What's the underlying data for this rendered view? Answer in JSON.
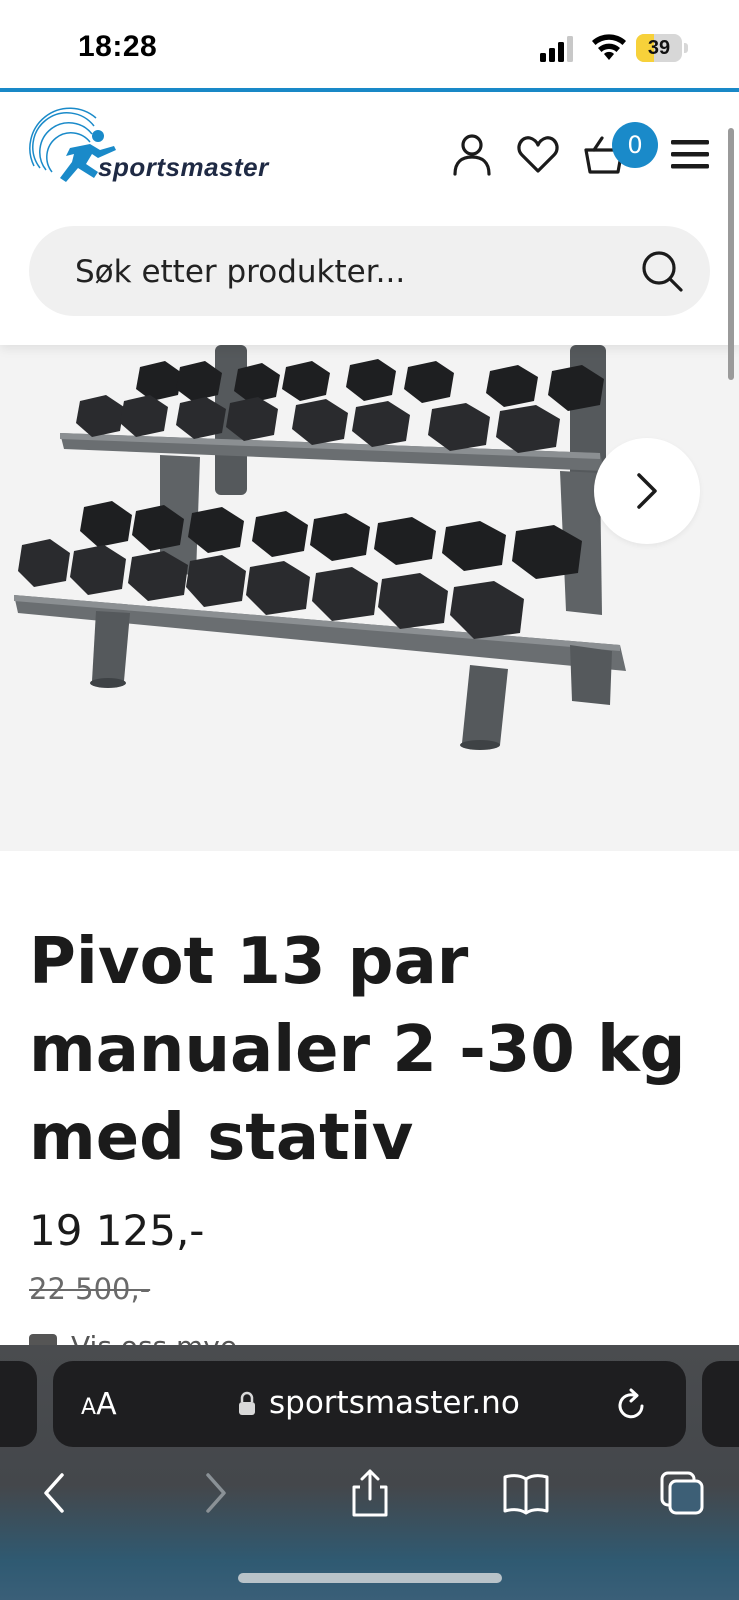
{
  "status_bar": {
    "time": "18:28",
    "battery_level": "39",
    "battery_fraction": 0.39,
    "battery_color": "#f7d13a"
  },
  "header": {
    "logo_text": "sportsmaster",
    "cart_count": "0",
    "accent_color": "#1a8ac9",
    "icons": [
      "user-icon",
      "heart-icon",
      "cart-icon",
      "menu-icon"
    ]
  },
  "search": {
    "placeholder": "Søk etter produkter..."
  },
  "product": {
    "image_alt": "dumbbell-rack-image",
    "title": "Pivot 13 par manualer 2 -30 kg med stativ",
    "price": "19 125,-",
    "old_price": "22 500,-",
    "partial_label": "Vis oss mye..."
  },
  "browser": {
    "aa_label_small": "A",
    "aa_label_large": "A",
    "url": "sportsmaster.no",
    "icons": [
      "back-icon",
      "forward-icon",
      "share-icon",
      "bookmarks-icon",
      "tabs-icon"
    ]
  }
}
